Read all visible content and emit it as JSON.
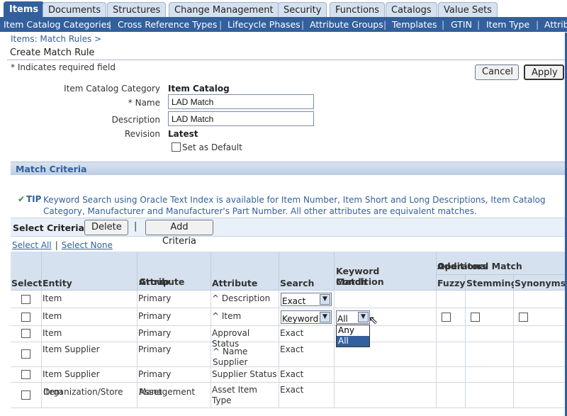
{
  "tabs": [
    "Items",
    "Documents",
    "Structures",
    "Change Management",
    "Security",
    "Functions",
    "Catalogs",
    "Value Sets"
  ],
  "subnav": [
    "Item Catalog Categories",
    "Cross Reference Types",
    "Lifecycle Phases",
    "Attribute Groups",
    "Templates",
    "GTIN",
    "Item Type",
    "Attribu"
  ],
  "breadcrumb": "Items: Match Rules >",
  "page_title": "Create Match Rule",
  "required_note": "* Indicates required field",
  "buttons": {
    "cancel": "Cancel",
    "apply": "Apply",
    "delete": "Delete",
    "add_criteria": "Add Criteria"
  },
  "form": {
    "catalog_label": "Item Catalog Category",
    "catalog_value": "Item Catalog",
    "name_label": "* Name",
    "name_value": "LAD Match",
    "description_label": "Description",
    "description_value": "LAD Match",
    "revision_label": "Revision",
    "revision_value": "Latest",
    "default_label": "Set as Default"
  },
  "section_title": "Match Criteria",
  "tip": {
    "label": "TIP",
    "text": "Keyword Search using Oracle Text Index is available for Item Number, Item Short and Long Descriptions, Item Catalog Category, Manufacturer and Manufacturer's Part Number. All other attributes are equivalent matches."
  },
  "criteria_label": "Select Criteria:",
  "criteria_sep": "|",
  "select_all": "Select All",
  "select_none": "Select None",
  "columns": {
    "select": "Select",
    "entity": "Entity",
    "attr_group_1": "Attribute",
    "attr_group_2": "Group",
    "attribute": "Attribute",
    "search": "Search",
    "keyword_1": "Keyword Match",
    "keyword_2": "Condition",
    "additional_1": "Additional Match",
    "additional_2": "Operators",
    "fuzzy": "Fuzzy",
    "stemming": "Stemming",
    "synonyms": "Synonyms"
  },
  "rows": [
    {
      "entity_1": "Item",
      "entity_2": "",
      "group_1": "Primary",
      "group_2": "",
      "attr_1": "^ Description",
      "attr_2": "",
      "search": "Exact"
    },
    {
      "entity_1": "Item",
      "entity_2": "",
      "group_1": "Primary",
      "group_2": "",
      "attr_1": "^ Item",
      "attr_2": "",
      "search": "Keyword",
      "keyword": "All"
    },
    {
      "entity_1": "Item",
      "entity_2": "",
      "group_1": "Primary",
      "group_2": "",
      "attr_1": "Approval Status",
      "attr_2": "",
      "search": "Exact"
    },
    {
      "entity_1": "Item Supplier",
      "entity_2": "",
      "group_1": "Primary",
      "group_2": "",
      "attr_1": "^ Supplier",
      "attr_2": "Name",
      "search": "Exact"
    },
    {
      "entity_1": "Item Supplier",
      "entity_2": "",
      "group_1": "Primary",
      "group_2": "",
      "attr_1": "Supplier Status",
      "attr_2": "",
      "search": "Exact"
    },
    {
      "entity_1": "Item",
      "entity_2": "Organization/Store",
      "group_1": "Asset",
      "group_2": "Management",
      "attr_1": "Asset Item Type",
      "attr_2": "",
      "search": "Exact"
    }
  ],
  "keyword_options": [
    "Any",
    "All"
  ],
  "colors": {
    "brand": "#33609c",
    "header_bg": "#d6e1ef"
  }
}
